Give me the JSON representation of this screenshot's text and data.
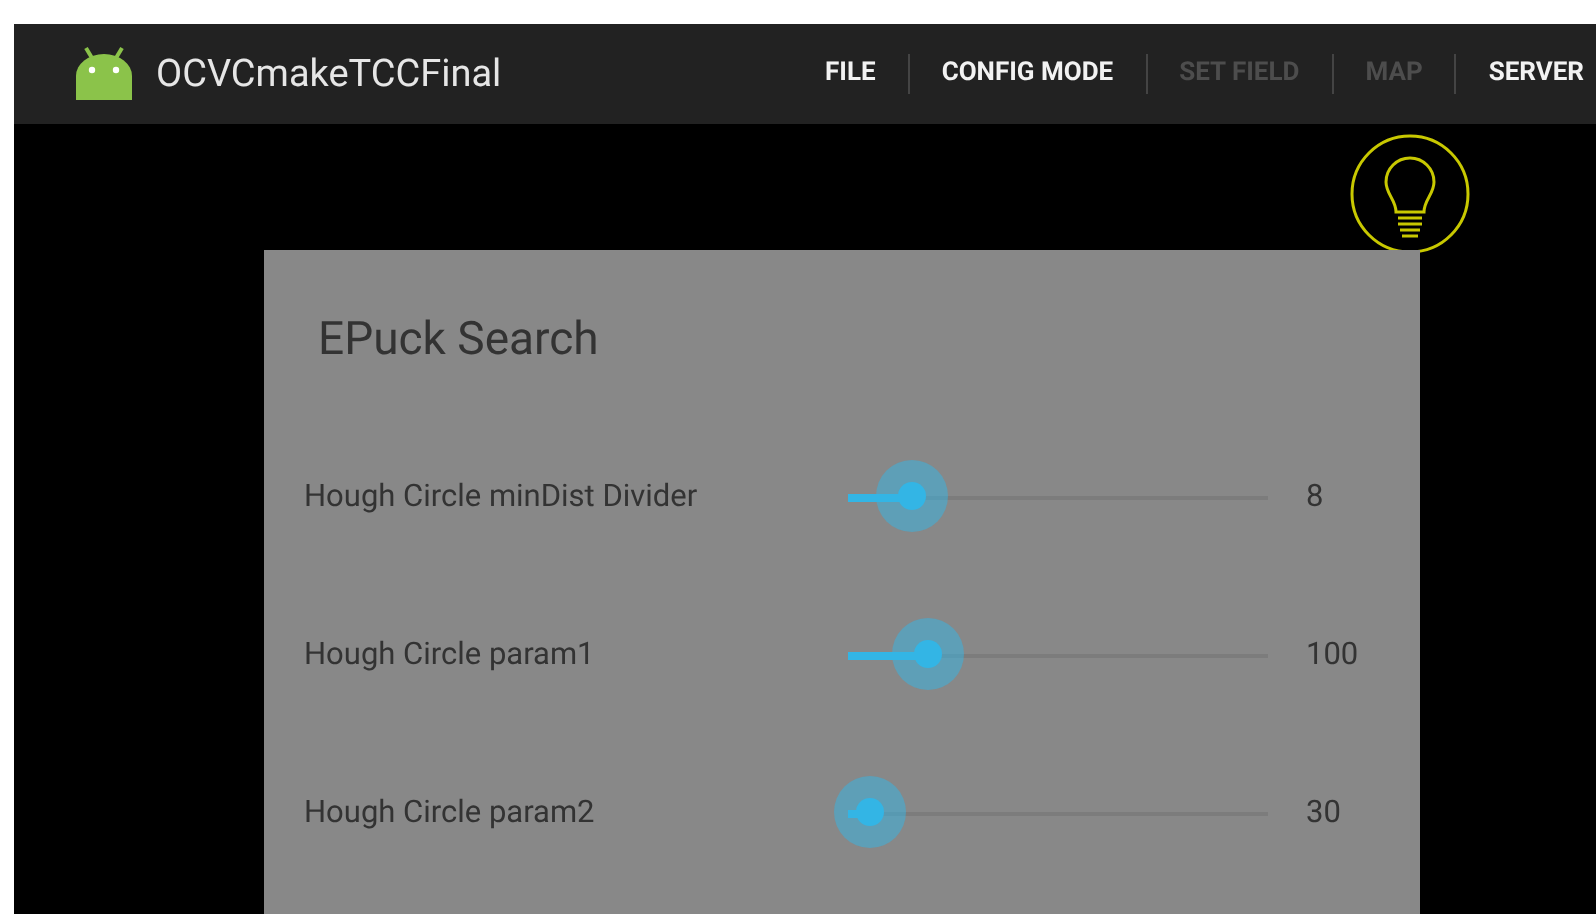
{
  "app_bar": {
    "title": "OCVCmakeTCCFinal",
    "menu": [
      {
        "label": "FILE",
        "disabled": false
      },
      {
        "label": "CONFIG MODE",
        "disabled": false
      },
      {
        "label": "SET FIELD",
        "disabled": true
      },
      {
        "label": "MAP",
        "disabled": true
      },
      {
        "label": "SERVER",
        "disabled": false
      }
    ]
  },
  "dialog": {
    "title": "EPuck Search",
    "rows": [
      {
        "label": "Hough Circle minDist Divider",
        "level": 0.15,
        "reading": "8"
      },
      {
        "label": "Hough Circle param1",
        "level": 0.19,
        "reading": "100"
      },
      {
        "label": "Hough Circle param2",
        "level": 0.05,
        "reading": "30"
      }
    ]
  }
}
